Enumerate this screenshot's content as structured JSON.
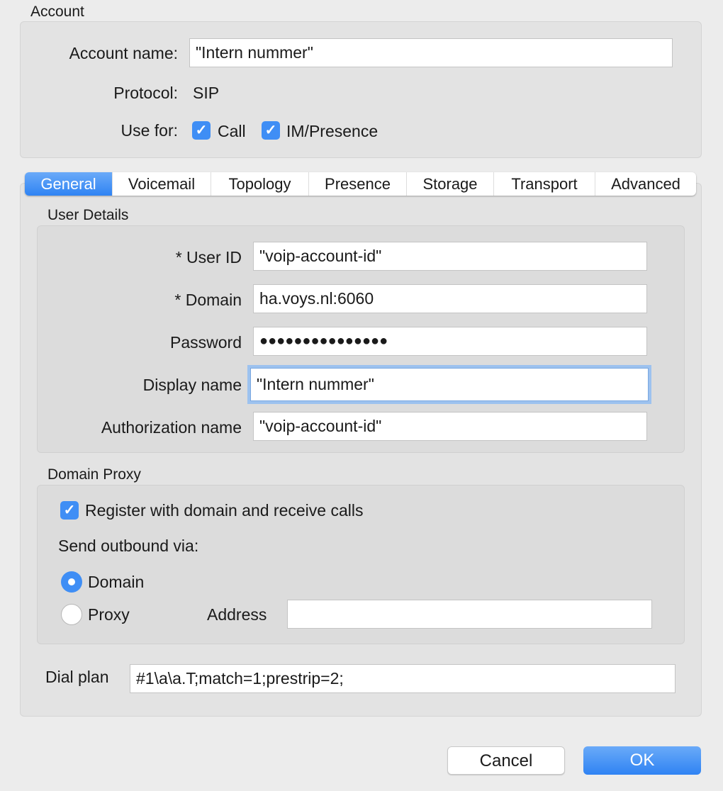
{
  "account": {
    "section_title": "Account",
    "name_label": "Account name:",
    "name_value": "\"Intern nummer\"",
    "protocol_label": "Protocol:",
    "protocol_value": "SIP",
    "use_for_label": "Use for:",
    "call_label": "Call",
    "call_checked": true,
    "im_label": "IM/Presence",
    "im_checked": true
  },
  "tabs": [
    {
      "label": "General",
      "active": true
    },
    {
      "label": "Voicemail"
    },
    {
      "label": "Topology"
    },
    {
      "label": "Presence"
    },
    {
      "label": "Storage"
    },
    {
      "label": "Transport"
    },
    {
      "label": "Advanced"
    }
  ],
  "user_details": {
    "title": "User Details",
    "user_id_label": "* User ID",
    "user_id": "\"voip-account-id\"",
    "domain_label": "* Domain",
    "domain": "ha.voys.nl:6060",
    "password_label": "Password",
    "password": "●●●●●●●●●●●●●●●",
    "display_name_label": "Display name",
    "display_name": "\"Intern nummer\"",
    "auth_name_label": "Authorization name",
    "auth_name": "\"voip-account-id\""
  },
  "domain_proxy": {
    "title": "Domain Proxy",
    "register_label": "Register with domain and receive calls",
    "register_checked": true,
    "send_via_label": "Send outbound via:",
    "domain_option": "Domain",
    "proxy_option": "Proxy",
    "selected": "Domain",
    "address_label": "Address",
    "address_value": ""
  },
  "dial_plan": {
    "label": "Dial plan",
    "value": "#1\\a\\a.T;match=1;prestrip=2;"
  },
  "buttons": {
    "cancel": "Cancel",
    "ok": "OK"
  },
  "colors": {
    "accent": "#3f8ef5"
  }
}
